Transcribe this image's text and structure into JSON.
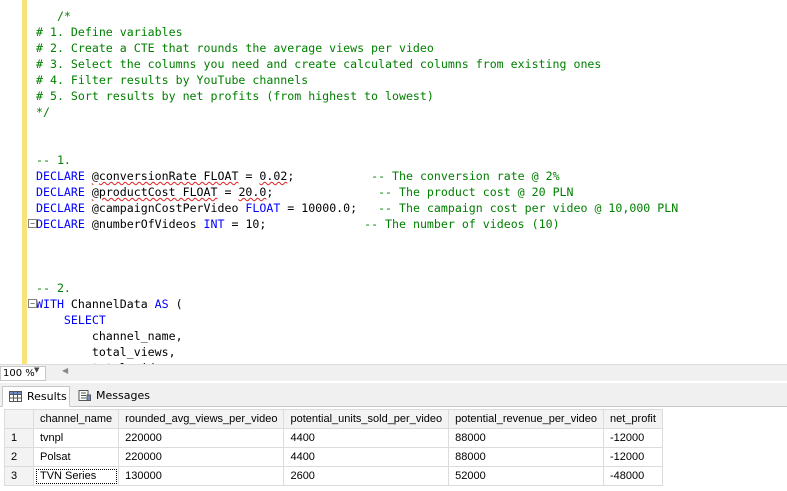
{
  "editor": {
    "lines": [
      {
        "indent": "   ",
        "tokens": [
          {
            "t": "/*",
            "c": "cm"
          }
        ]
      },
      {
        "tokens": [
          {
            "t": "# 1. Define variables",
            "c": "cm"
          }
        ]
      },
      {
        "tokens": [
          {
            "t": "# 2. Create a CTE that rounds the average views per video",
            "c": "cm"
          }
        ]
      },
      {
        "tokens": [
          {
            "t": "# 3. Select the columns you need and create calculated columns from existing ones",
            "c": "cm"
          }
        ]
      },
      {
        "tokens": [
          {
            "t": "# 4. Filter results by YouTube channels",
            "c": "cm"
          }
        ]
      },
      {
        "tokens": [
          {
            "t": "# 5. Sort results by net profits (from highest to lowest)",
            "c": "cm"
          }
        ]
      },
      {
        "tokens": [
          {
            "t": "*/",
            "c": "cm"
          }
        ]
      },
      {
        "tokens": []
      },
      {
        "tokens": []
      },
      {
        "tokens": [
          {
            "t": "-- 1.",
            "c": "cm"
          }
        ]
      },
      {
        "tokens": [
          {
            "t": "DECLARE",
            "c": "kw"
          },
          {
            "t": " "
          },
          {
            "t": "@conversionRate FLOAT",
            "c": "id sq"
          },
          {
            "t": " = "
          },
          {
            "t": "0.02",
            "c": "id sq"
          },
          {
            "t": ";"
          },
          {
            "t": "           "
          },
          {
            "t": "-- The conversion rate @ 2%",
            "c": "cm"
          }
        ]
      },
      {
        "tokens": [
          {
            "t": "DECLARE",
            "c": "kw"
          },
          {
            "t": " "
          },
          {
            "t": "@productCost FLOAT",
            "c": "id sq"
          },
          {
            "t": " = "
          },
          {
            "t": "20.0",
            "c": "id sq"
          },
          {
            "t": ";"
          },
          {
            "t": "               "
          },
          {
            "t": "-- The product cost @ 20 PLN",
            "c": "cm"
          }
        ]
      },
      {
        "tokens": [
          {
            "t": "DECLARE",
            "c": "kw"
          },
          {
            "t": " @campaignCostPerVideo "
          },
          {
            "t": "FLOAT",
            "c": "kw"
          },
          {
            "t": " = 10000.0;   "
          },
          {
            "t": "-- The campaign cost per video @ 10,000 PLN",
            "c": "cm"
          }
        ]
      },
      {
        "fold": "−",
        "tokens": [
          {
            "t": "DECLARE",
            "c": "kw"
          },
          {
            "t": " @numberOfVideos "
          },
          {
            "t": "INT",
            "c": "kw"
          },
          {
            "t": " = 10;              "
          },
          {
            "t": "-- The number of videos (10)",
            "c": "cm"
          }
        ]
      },
      {
        "tokens": []
      },
      {
        "tokens": []
      },
      {
        "tokens": []
      },
      {
        "tokens": [
          {
            "t": "-- 2.",
            "c": "cm"
          }
        ]
      },
      {
        "fold": "−",
        "tokens": [
          {
            "t": "WITH",
            "c": "kw"
          },
          {
            "t": " ChannelData "
          },
          {
            "t": "AS",
            "c": "kw"
          },
          {
            "t": " ("
          }
        ]
      },
      {
        "tokens": [
          {
            "t": "    "
          },
          {
            "t": "SELECT",
            "c": "kw"
          }
        ]
      },
      {
        "tokens": [
          {
            "t": "        channel_name,"
          }
        ]
      },
      {
        "tokens": [
          {
            "t": "        total_views,"
          }
        ]
      },
      {
        "tokens": [
          {
            "t": "        total_videos,"
          }
        ]
      }
    ]
  },
  "zoom": {
    "value": "100 %"
  },
  "tabs": {
    "results": "Results",
    "messages": "Messages"
  },
  "grid": {
    "columns": [
      "channel_name",
      "rounded_avg_views_per_video",
      "potential_units_sold_per_video",
      "potential_revenue_per_video",
      "net_profit"
    ],
    "rows": [
      {
        "num": "1",
        "cells": [
          "tvnpl",
          "220000",
          "4400",
          "88000",
          "-12000"
        ]
      },
      {
        "num": "2",
        "cells": [
          "Polsat",
          "220000",
          "4400",
          "88000",
          "-12000"
        ]
      },
      {
        "num": "3",
        "cells": [
          "TVN Series",
          "130000",
          "2600",
          "52000",
          "-48000"
        ]
      }
    ]
  }
}
